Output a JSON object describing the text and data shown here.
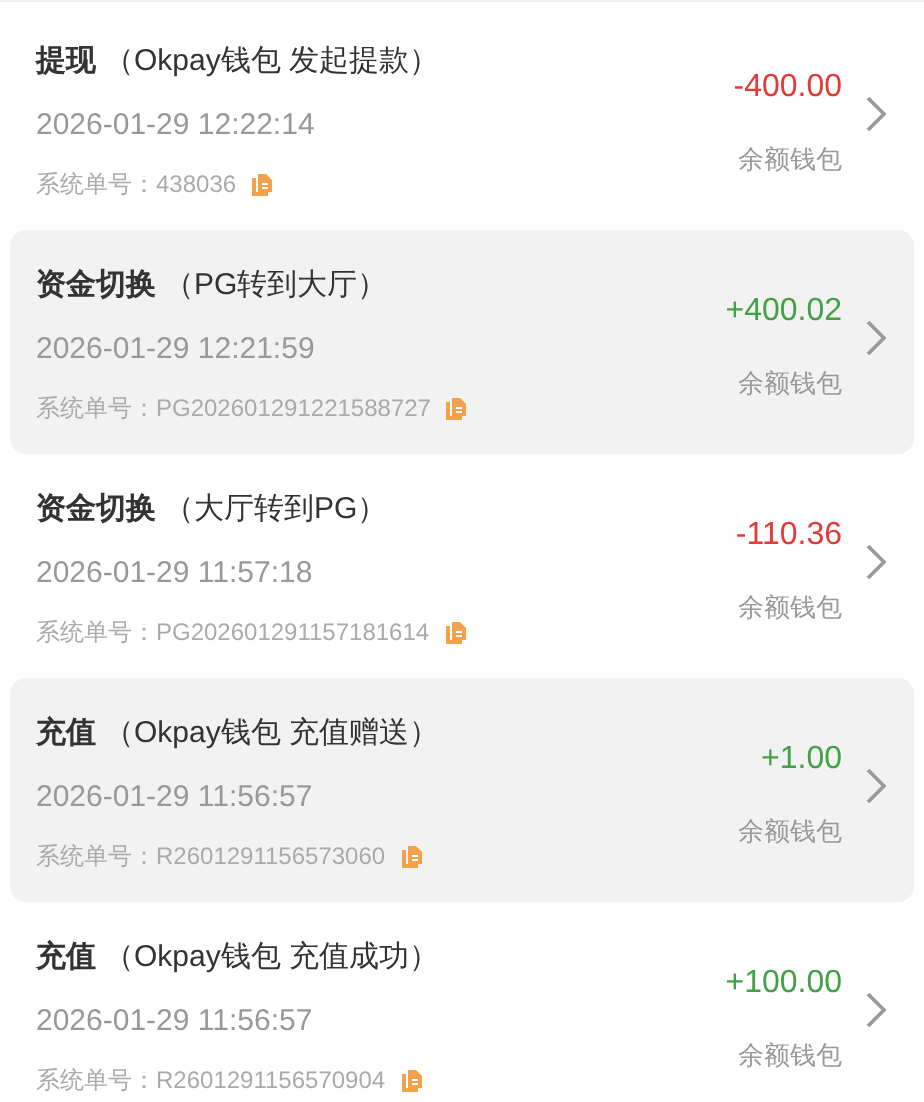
{
  "records": [
    {
      "type": "提现",
      "detail": "（Okpay钱包 发起提款）",
      "time": "2026-01-29 12:22:14",
      "order": "系统单号：438036",
      "amount": "-400.00",
      "kind": "debit",
      "wallet": "余额钱包",
      "highlighted": false
    },
    {
      "type": "资金切换",
      "detail": "（PG转到大厅）",
      "time": "2026-01-29 12:21:59",
      "order": "系统单号：PG202601291221588727",
      "amount": "+400.02",
      "kind": "credit",
      "wallet": "余额钱包",
      "highlighted": true
    },
    {
      "type": "资金切换",
      "detail": "（大厅转到PG）",
      "time": "2026-01-29 11:57:18",
      "order": "系统单号：PG202601291157181614",
      "amount": "-110.36",
      "kind": "debit",
      "wallet": "余额钱包",
      "highlighted": false
    },
    {
      "type": "充值",
      "detail": "（Okpay钱包 充值赠送）",
      "time": "2026-01-29 11:56:57",
      "order": "系统单号：R2601291156573060",
      "amount": "+1.00",
      "kind": "credit",
      "wallet": "余额钱包",
      "highlighted": true
    },
    {
      "type": "充值",
      "detail": "（Okpay钱包 充值成功）",
      "time": "2026-01-29 11:56:57",
      "order": "系统单号：R2601291156570904",
      "amount": "+100.00",
      "kind": "credit",
      "wallet": "余额钱包",
      "highlighted": false
    }
  ]
}
